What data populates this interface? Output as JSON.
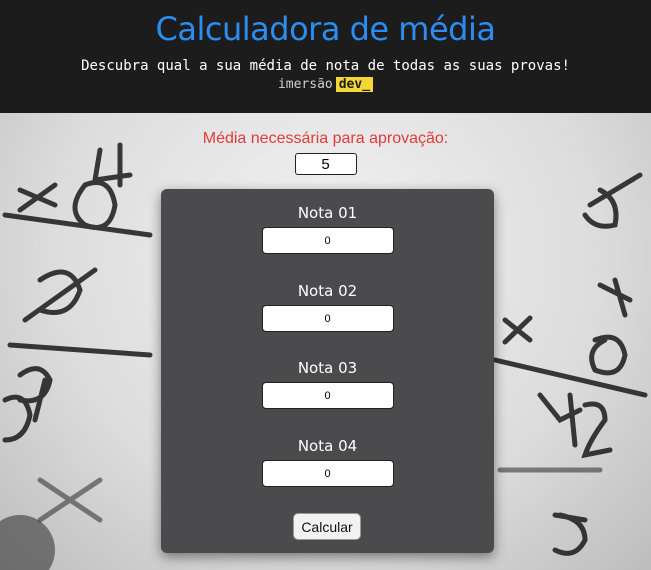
{
  "header": {
    "title": "Calculadora de média",
    "subtitle": "Descubra qual a sua média de nota de todas as suas provas!",
    "brand_prefix": "imersão",
    "brand_tag": "dev_"
  },
  "approval": {
    "label": "Média necessária para aprovação:",
    "value": "5"
  },
  "notas": [
    {
      "label": "Nota 01",
      "value": "0"
    },
    {
      "label": "Nota 02",
      "value": "0"
    },
    {
      "label": "Nota 03",
      "value": "0"
    },
    {
      "label": "Nota 04",
      "value": "0"
    }
  ],
  "calculate_label": "Calcular",
  "colors": {
    "title": "#2b8cf2",
    "header_bg": "#1c1c1c",
    "approval_label": "#e23a3a",
    "card_bg": "#4b4b4d",
    "brand_tag_bg": "#f4d637"
  }
}
